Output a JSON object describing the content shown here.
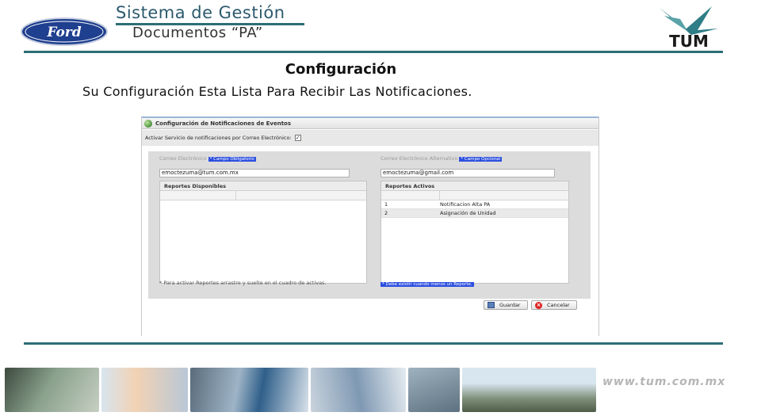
{
  "header": {
    "brand_logo_text": "Ford",
    "system_title": "Sistema de Gestión",
    "system_subtitle": "Documentos “PA”",
    "partner_logo_text": "TUM"
  },
  "slide": {
    "heading": "Configuración",
    "message": "Su Configuración Esta Lista Para Recibir Las Notificaciones."
  },
  "window": {
    "title": "Configuración de Notificaciones de Eventos",
    "activate_label": "Activar Servicio de notificaciones por Correo Electrónico:",
    "activate_checked": "✓",
    "primary_email": {
      "label": "Correo Electrónico",
      "badge": "* Campo Obligatorio",
      "value": "emoctezuma@tum.com.mx"
    },
    "alt_email": {
      "label": "Correo Electrónico Alternativo",
      "badge": "* Campo Opcional",
      "value": "emoctezuma@gmail.com"
    },
    "available_reports": {
      "header": "Reportes Disponibles",
      "rows": []
    },
    "active_reports": {
      "header": "Reportes Activos",
      "rows": [
        {
          "n": "1",
          "name": "Notificacion Alta PA"
        },
        {
          "n": "2",
          "name": "Asignación de Unidad"
        }
      ]
    },
    "note_left": "* Para activar Reportes arrastre y suelte en el cuadro de activas.",
    "note_right": "* Debe existir cuando menos un Reporte.",
    "save_label": "Guardar",
    "cancel_label": "Cancelar"
  },
  "footer": {
    "website": "www.tum.com.mx"
  },
  "colors": {
    "accent_rule": "#2c6e74",
    "badge_blue": "#2c4fe0",
    "ford_blue": "#1f3f8f"
  }
}
